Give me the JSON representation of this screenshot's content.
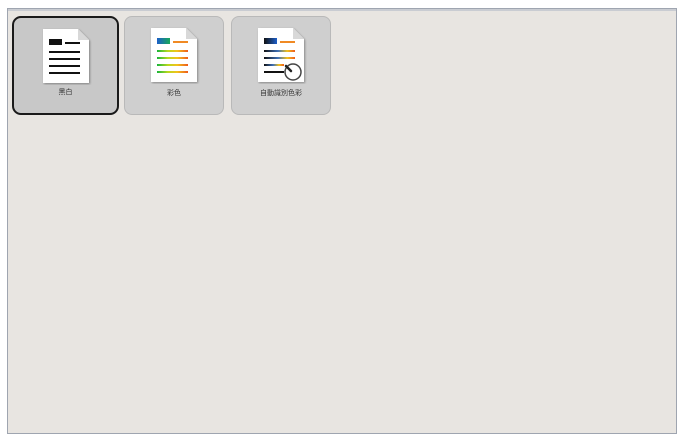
{
  "modes": [
    {
      "label": "黑白",
      "icon": "document-bw-icon",
      "selected": true
    },
    {
      "label": "彩色",
      "icon": "document-color-icon",
      "selected": false
    },
    {
      "label": "自動識別色彩",
      "icon": "document-auto-color-icon",
      "selected": false
    }
  ],
  "colors": {
    "panel_bg": "#e8e5e1",
    "button_bg": "#cfcfcf",
    "selected_border": "#1a1a1a"
  }
}
